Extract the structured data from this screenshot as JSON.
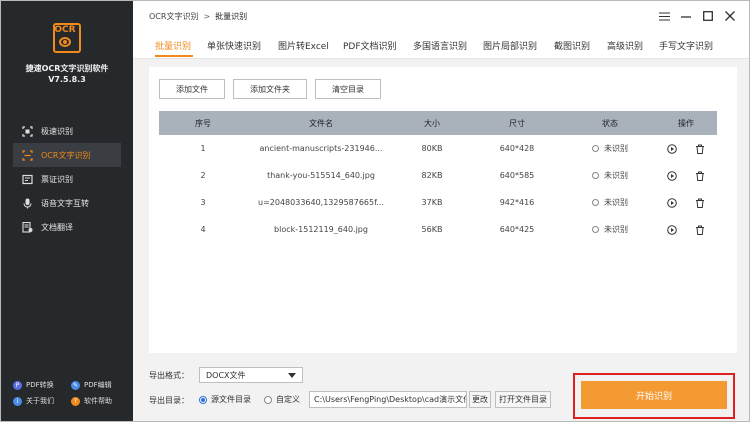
{
  "app": {
    "logo_text": "OCR",
    "name": "捷速OCR文字识别软件",
    "version": "V7.5.8.3"
  },
  "sidebar": {
    "items": [
      {
        "label": "极速识别",
        "icon": "crop-scan-icon",
        "active": false
      },
      {
        "label": "OCR文字识别",
        "icon": "ocr-scan-icon",
        "active": true
      },
      {
        "label": "票证识别",
        "icon": "receipt-icon",
        "active": false
      },
      {
        "label": "语音文字互转",
        "icon": "microphone-icon",
        "active": false
      },
      {
        "label": "文档翻译",
        "icon": "translate-doc-icon",
        "active": false
      }
    ],
    "footer": [
      {
        "label": "PDF转换",
        "color": "#5b6ee1"
      },
      {
        "label": "PDF编辑",
        "color": "#4a8be8"
      },
      {
        "label": "关于我们",
        "color": "#4a8be8"
      },
      {
        "label": "软件帮助",
        "color": "#f28a1b"
      }
    ]
  },
  "breadcrumb": {
    "parent": "OCR文字识别",
    "separator": ">",
    "current": "批量识别"
  },
  "tabs": [
    "批量识别",
    "单张快速识别",
    "图片转Excel",
    "PDF文档识别",
    "多国语言识别",
    "图片局部识别",
    "截图识别",
    "高级识别",
    "手写文字识别"
  ],
  "toolbar": {
    "add_file": "添加文件",
    "add_folder": "添加文件夹",
    "clear": "清空目录"
  },
  "table": {
    "headers": [
      "序号",
      "文件名",
      "大小",
      "尺寸",
      "状态",
      "操作"
    ],
    "rows": [
      {
        "index": "1",
        "name": "ancient-manuscripts-231946...",
        "size": "80KB",
        "dims": "640*428",
        "status": "未识别"
      },
      {
        "index": "2",
        "name": "thank-you-515514_640.jpg",
        "size": "82KB",
        "dims": "640*585",
        "status": "未识别"
      },
      {
        "index": "3",
        "name": "u=2048033640,1329587665f...",
        "size": "37KB",
        "dims": "942*416",
        "status": "未识别"
      },
      {
        "index": "4",
        "name": "block-1512119_640.jpg",
        "size": "56KB",
        "dims": "640*425",
        "status": "未识别"
      }
    ]
  },
  "bottom": {
    "format_label": "导出格式：",
    "format_value": "DOCX文件",
    "dir_label": "导出目录：",
    "radio_source": "源文件目录",
    "radio_custom": "自定义",
    "path_value": "C:\\Users\\FengPing\\Desktop\\cad演示文件",
    "change_btn": "更改",
    "open_btn": "打开文件目录",
    "start_btn": "开始识别"
  },
  "colors": {
    "accent": "#f28a1b",
    "sidebar_bg": "#26292c",
    "highlight_frame": "#e02020",
    "table_header": "#a9b1bb"
  }
}
